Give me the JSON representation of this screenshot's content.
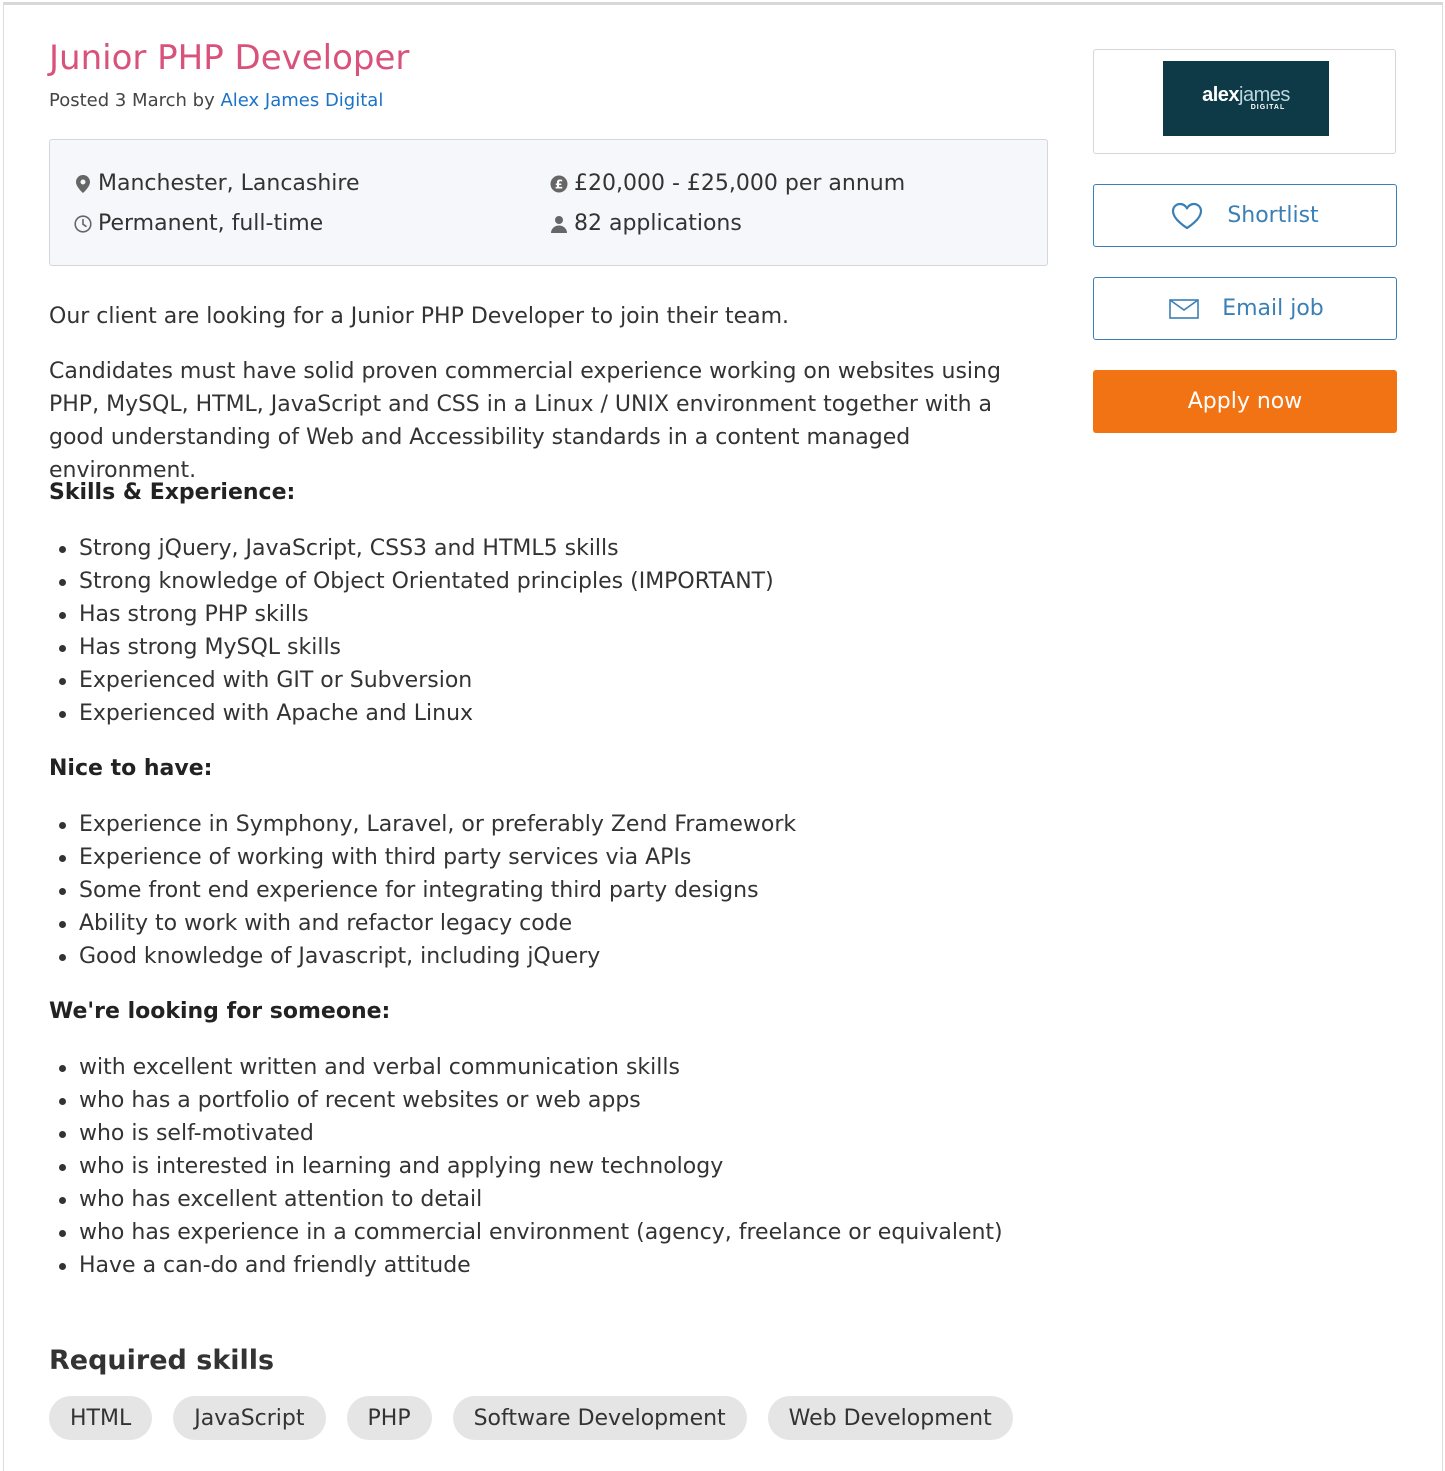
{
  "job": {
    "title": "Junior PHP Developer",
    "posted_prefix": "Posted 3 March by ",
    "recruiter": "Alex James Digital"
  },
  "summary": {
    "location": "Manchester, Lancashire",
    "salary": "£20,000 - £25,000 per annum",
    "job_type": "Permanent, full-time",
    "applications": "82 applications"
  },
  "description": {
    "intro": "Our client are looking for a Junior PHP Developer to join their team.",
    "requirements": "Candidates must have solid proven commercial experience working on websites using PHP, MySQL, HTML, JavaScript and CSS in a Linux / UNIX environment together with a good understanding of Web and Accessibility standards in a content managed environment."
  },
  "sections": {
    "skills": {
      "heading": "Skills & Experience:",
      "items": [
        "Strong jQuery, JavaScript, CSS3 and HTML5 skills",
        "Strong knowledge of Object Orientated principles (IMPORTANT)",
        "Has strong PHP skills",
        "Has strong MySQL skills",
        "Experienced with GIT or Subversion",
        "Experienced with Apache and Linux"
      ]
    },
    "nice": {
      "heading": "Nice to have:",
      "items": [
        "Experience in Symphony, Laravel, or preferably Zend Framework",
        "Experience of working with third party services via APIs",
        "Some front end experience for integrating third party designs",
        "Ability to work with and refactor legacy code",
        "Good knowledge of Javascript, including jQuery"
      ]
    },
    "someone": {
      "heading": "We're looking for someone:",
      "items": [
        "with excellent written and verbal communication skills",
        "who has a portfolio of recent websites or web apps",
        "who is self-motivated",
        "who is interested in learning and applying new technology",
        "who has excellent attention to detail",
        "who has experience in a commercial environment (agency, freelance or equivalent)",
        "Have a can-do and friendly attitude"
      ]
    }
  },
  "required_skills": {
    "title": "Required skills",
    "chips": [
      "HTML",
      "JavaScript",
      "PHP",
      "Software Development",
      "Web Development"
    ]
  },
  "sidebar": {
    "logo": {
      "word1": "alex",
      "word2": "james",
      "tagline": "DIGITAL",
      "bg_color": "#0e3a48"
    },
    "shortlist_label": "Shortlist",
    "email_label": "Email job",
    "apply_label": "Apply now"
  },
  "colors": {
    "title": "#d9527c",
    "link": "#1a73c8",
    "outline_button": "#3a7fb5",
    "apply_button": "#f27314",
    "chip_bg": "#e5e5e5",
    "summary_bg": "#f5f7fa"
  },
  "icons": {
    "location": "map-pin-icon",
    "salary": "pound-coin-icon",
    "job_type": "clock-icon",
    "applications": "person-icon",
    "shortlist": "heart-outline-icon",
    "email": "envelope-icon"
  }
}
